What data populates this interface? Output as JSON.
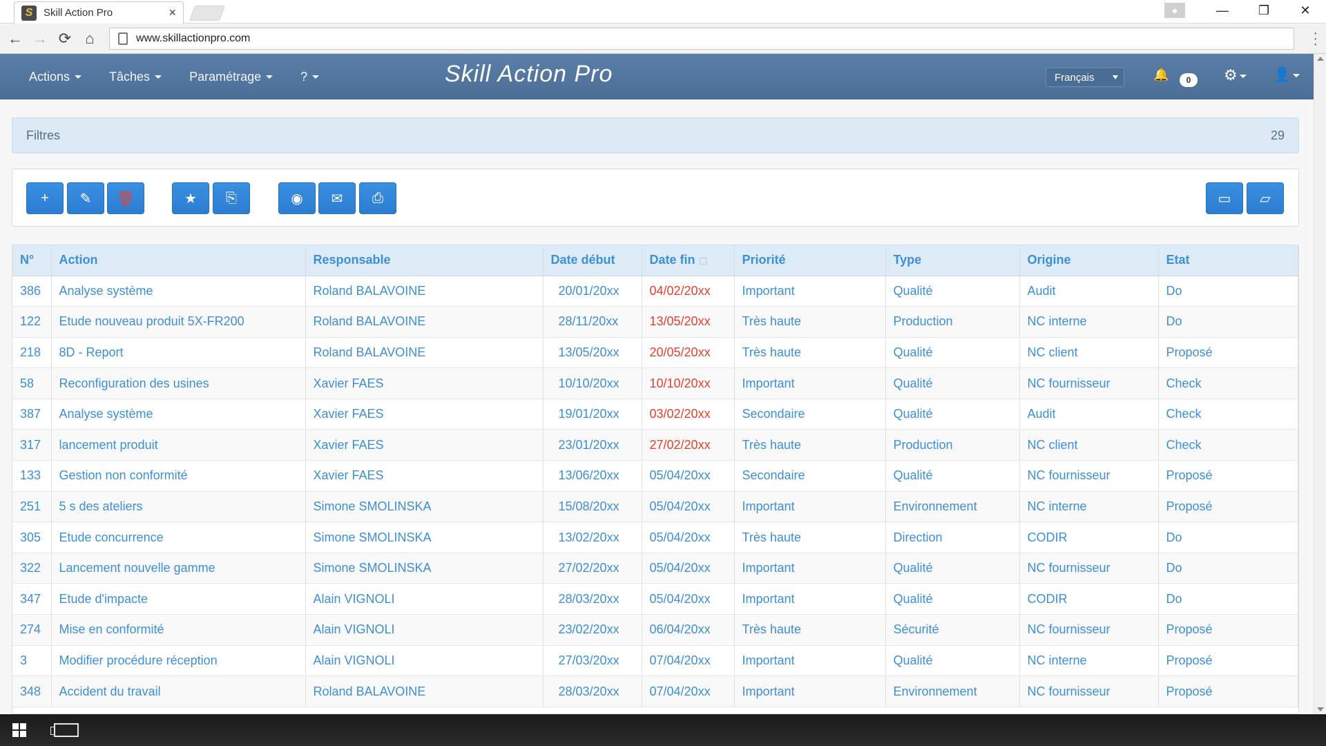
{
  "browser": {
    "tab_title": "Skill Action Pro",
    "tab_close": "×",
    "url": "www.skillactionpro.com",
    "nav": {
      "back": "←",
      "forward": "→",
      "reload": "⟳",
      "home": "⌂"
    },
    "window": {
      "minimize": "—",
      "restore": "❐",
      "close": "✕"
    }
  },
  "app": {
    "brand": "Skill Action Pro",
    "menu": [
      {
        "label": "Actions"
      },
      {
        "label": "Tâches"
      },
      {
        "label": "Paramétrage"
      },
      {
        "label": "?"
      }
    ],
    "language": "Français",
    "notifications_count": "0"
  },
  "filters": {
    "label": "Filtres",
    "count": "29"
  },
  "toolbar": {
    "buttons": [
      {
        "name": "add",
        "icon": "plus-icon",
        "glyph": "+"
      },
      {
        "name": "edit",
        "icon": "edit-icon",
        "glyph": "✎"
      },
      {
        "name": "delete",
        "icon": "trash-icon",
        "glyph": "🗑"
      },
      {
        "name": "favorite",
        "icon": "star-icon",
        "glyph": "★"
      },
      {
        "name": "duplicate",
        "icon": "copy-icon",
        "glyph": "⎘"
      },
      {
        "name": "view",
        "icon": "eye-icon",
        "glyph": "◉"
      },
      {
        "name": "email",
        "icon": "envelope-icon",
        "glyph": "✉"
      },
      {
        "name": "print",
        "icon": "print-icon",
        "glyph": "⎙"
      },
      {
        "name": "folder",
        "icon": "folder-icon",
        "glyph": "▭"
      },
      {
        "name": "folder-open",
        "icon": "folder-open-icon",
        "glyph": "▱"
      }
    ]
  },
  "table": {
    "headers": [
      "N°",
      "Action",
      "Responsable",
      "Date début",
      "Date fin",
      "Priorité",
      "Type",
      "Origine",
      "Etat"
    ],
    "rows": [
      {
        "id": "386",
        "action": "Analyse système",
        "responsable": "Roland BALAVOINE",
        "start": "20/01/20xx",
        "end": "04/02/20xx",
        "late": true,
        "priority": "Important",
        "type": "Qualité",
        "origin": "Audit",
        "state": "Do"
      },
      {
        "id": "122",
        "action": "Etude nouveau produit 5X-FR200",
        "responsable": "Roland BALAVOINE",
        "start": "28/11/20xx",
        "end": "13/05/20xx",
        "late": true,
        "priority": "Très haute",
        "type": "Production",
        "origin": "NC interne",
        "state": "Do"
      },
      {
        "id": "218",
        "action": "8D - Report",
        "responsable": "Roland BALAVOINE",
        "start": "13/05/20xx",
        "end": "20/05/20xx",
        "late": true,
        "priority": "Très haute",
        "type": "Qualité",
        "origin": "NC client",
        "state": "Proposé"
      },
      {
        "id": "58",
        "action": "Reconfiguration des usines",
        "responsable": "Xavier FAES",
        "start": "10/10/20xx",
        "end": "10/10/20xx",
        "late": true,
        "priority": "Important",
        "type": "Qualité",
        "origin": "NC fournisseur",
        "state": "Check"
      },
      {
        "id": "387",
        "action": "Analyse système",
        "responsable": "Xavier FAES",
        "start": "19/01/20xx",
        "end": "03/02/20xx",
        "late": true,
        "priority": "Secondaire",
        "type": "Qualité",
        "origin": "Audit",
        "state": "Check"
      },
      {
        "id": "317",
        "action": "lancement produit",
        "responsable": "Xavier FAES",
        "start": "23/01/20xx",
        "end": "27/02/20xx",
        "late": true,
        "priority": "Très haute",
        "type": "Production",
        "origin": "NC client",
        "state": "Check"
      },
      {
        "id": "133",
        "action": "Gestion non conformité",
        "responsable": "Xavier FAES",
        "start": "13/06/20xx",
        "end": "05/04/20xx",
        "late": false,
        "priority": "Secondaire",
        "type": "Qualité",
        "origin": "NC fournisseur",
        "state": "Proposé"
      },
      {
        "id": "251",
        "action": "5 s des ateliers",
        "responsable": "Simone SMOLINSKA",
        "start": "15/08/20xx",
        "end": "05/04/20xx",
        "late": false,
        "priority": "Important",
        "type": "Environnement",
        "origin": "NC interne",
        "state": "Proposé"
      },
      {
        "id": "305",
        "action": "Etude concurrence",
        "responsable": "Simone SMOLINSKA",
        "start": "13/02/20xx",
        "end": "05/04/20xx",
        "late": false,
        "priority": "Très haute",
        "type": "Direction",
        "origin": "CODIR",
        "state": "Do"
      },
      {
        "id": "322",
        "action": "Lancement nouvelle gamme",
        "responsable": "Simone SMOLINSKA",
        "start": "27/02/20xx",
        "end": "05/04/20xx",
        "late": false,
        "priority": "Important",
        "type": "Qualité",
        "origin": "NC fournisseur",
        "state": "Do"
      },
      {
        "id": "347",
        "action": "Etude d'impacte",
        "responsable": "Alain VIGNOLI",
        "start": "28/03/20xx",
        "end": "05/04/20xx",
        "late": false,
        "priority": "Important",
        "type": "Qualité",
        "origin": "CODIR",
        "state": "Do"
      },
      {
        "id": "274",
        "action": "Mise en conformité",
        "responsable": "Alain VIGNOLI",
        "start": "23/02/20xx",
        "end": "06/04/20xx",
        "late": false,
        "priority": "Très haute",
        "type": "Sécurité",
        "origin": "NC fournisseur",
        "state": "Proposé"
      },
      {
        "id": "3",
        "action": "Modifier procédure réception",
        "responsable": "Alain VIGNOLI",
        "start": "27/03/20xx",
        "end": "07/04/20xx",
        "late": false,
        "priority": "Important",
        "type": "Qualité",
        "origin": "NC interne",
        "state": "Proposé"
      },
      {
        "id": "348",
        "action": "Accident du travail",
        "responsable": "Roland BALAVOINE",
        "start": "28/03/20xx",
        "end": "07/04/20xx",
        "late": false,
        "priority": "Important",
        "type": "Environnement",
        "origin": "NC fournisseur",
        "state": "Proposé"
      }
    ]
  },
  "colors": {
    "navbar": "#4f739b",
    "link": "#3d8fd6",
    "late": "#e5402f",
    "button": "#2f82d6"
  }
}
